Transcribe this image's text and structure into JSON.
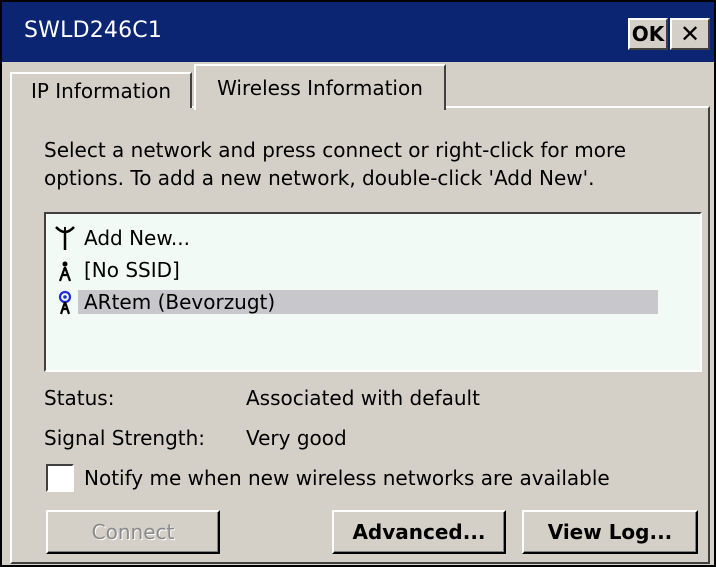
{
  "window": {
    "title": "SWLD246C1",
    "ok_label": "OK",
    "close_label": "✕"
  },
  "tabs": [
    {
      "label": "IP Information",
      "active": false
    },
    {
      "label": "Wireless Information",
      "active": true
    }
  ],
  "instructions": "Select a network and press connect or right-click for more options.  To add a new network, double-click 'Add New'.",
  "networks": [
    {
      "label": "Add New...",
      "icon": "antenna-icon",
      "selected": false
    },
    {
      "label": "[No SSID]",
      "icon": "adhoc-network-icon",
      "selected": false
    },
    {
      "label": "ARtem (Bevorzugt)",
      "icon": "connected-network-icon",
      "selected": true
    }
  ],
  "status": {
    "label": "Status:",
    "value": "Associated with default"
  },
  "signal": {
    "label": "Signal Strength:",
    "value": "Very good"
  },
  "notify": {
    "label": "Notify me when new wireless networks are available",
    "checked": false
  },
  "buttons": {
    "connect": "Connect",
    "advanced": "Advanced...",
    "view_log": "View Log..."
  },
  "colors": {
    "titlebar": "#0b2573",
    "face": "#d4d0c8",
    "list_background": "#f1faf5",
    "selection": "#c8c8cc"
  }
}
